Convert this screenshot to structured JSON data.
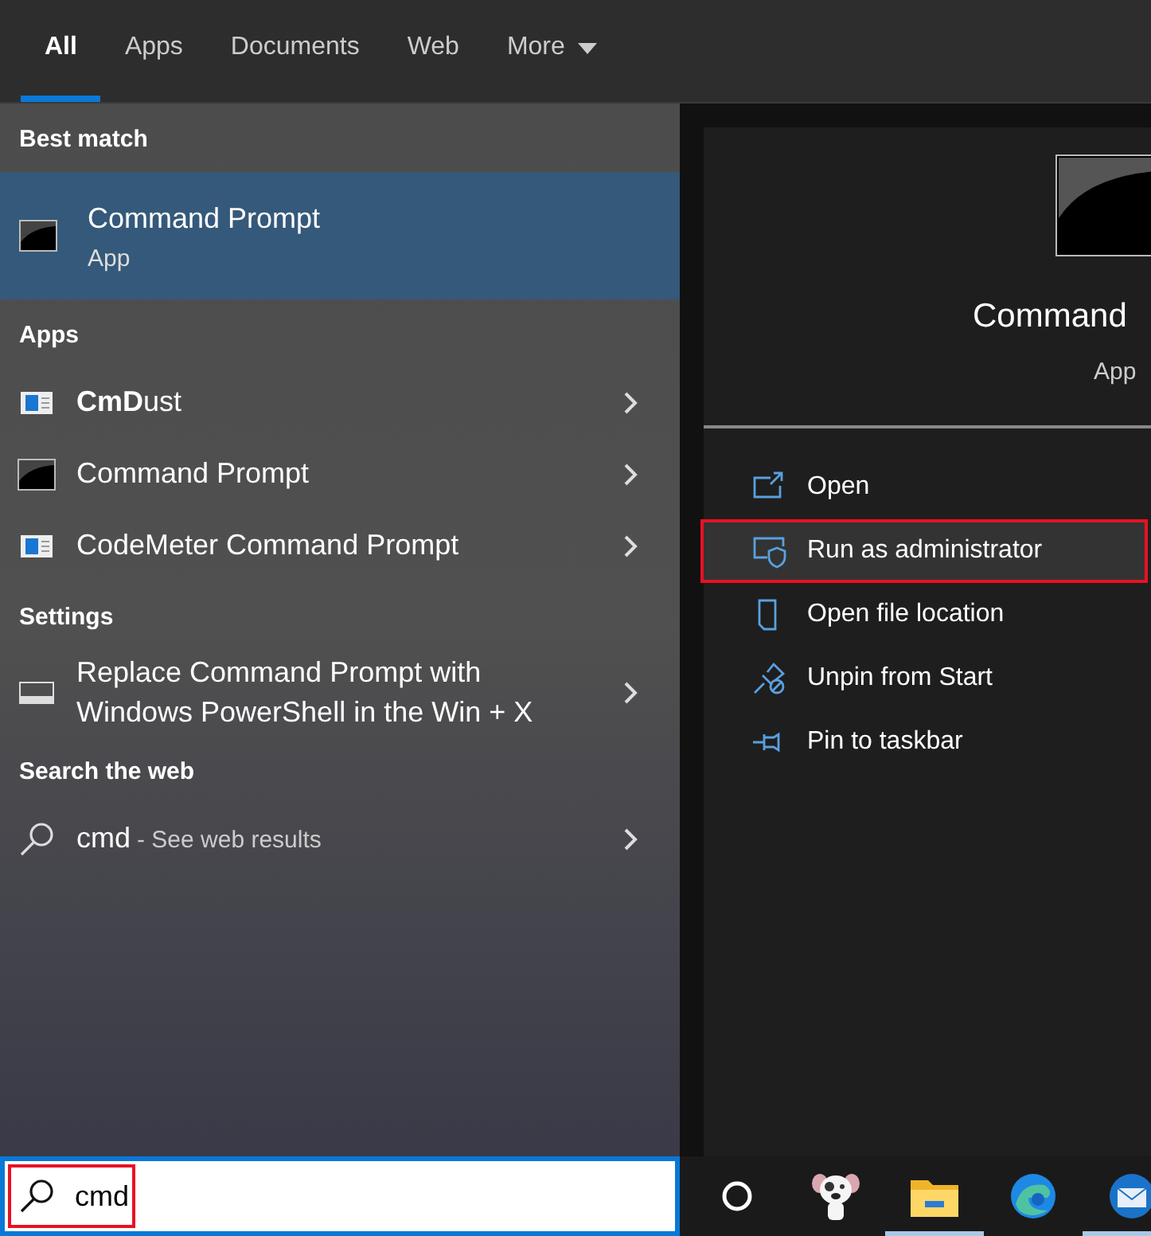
{
  "tabs": [
    {
      "label": "All",
      "selected": true
    },
    {
      "label": "Apps",
      "selected": false
    },
    {
      "label": "Documents",
      "selected": false
    },
    {
      "label": "Web",
      "selected": false
    },
    {
      "label": "More",
      "selected": false,
      "kind": "dropdown"
    }
  ],
  "sections": [
    {
      "heading": "Best match",
      "items": [
        {
          "kind": "best",
          "title": "Command Prompt",
          "subtitle": "App",
          "selected": true
        }
      ]
    },
    {
      "heading": "Apps",
      "items": [
        {
          "kind": "window",
          "title": "**CmD**ust",
          "selected": false
        },
        {
          "kind": "console",
          "title": "Command Prompt",
          "selected": false
        },
        {
          "kind": "window",
          "title": "CodeMeter Command Prompt",
          "selected": false
        }
      ]
    },
    {
      "heading": "Settings",
      "items": [
        {
          "kind": "display",
          "title": "Replace Command Prompt with Windows PowerShell in the Win + X",
          "selected": false
        }
      ]
    },
    {
      "heading": "Search the web",
      "items": [
        {
          "kind": "web",
          "title": "cmd",
          "suffix": "- See web results",
          "selected": false
        }
      ]
    }
  ],
  "preview": {
    "title": "Command",
    "subtitle": "App"
  },
  "actions": [
    {
      "kind": "open",
      "label": "Open",
      "highlighted": false
    },
    {
      "kind": "shield",
      "label": "Run as administrator",
      "highlighted": true
    },
    {
      "kind": "folder",
      "label": "Open file location",
      "highlighted": false
    },
    {
      "kind": "unpin",
      "label": "Unpin from Start",
      "highlighted": false
    },
    {
      "kind": "pin",
      "label": "Pin to taskbar",
      "highlighted": false
    }
  ],
  "search": {
    "value": "cmd",
    "highlighted": true
  },
  "taskbar": [
    {
      "kind": "circle",
      "running": false
    },
    {
      "kind": "dog",
      "running": false
    },
    {
      "kind": "explorer",
      "running": true
    },
    {
      "kind": "edge",
      "running": false
    },
    {
      "kind": "mail",
      "running": true
    }
  ]
}
